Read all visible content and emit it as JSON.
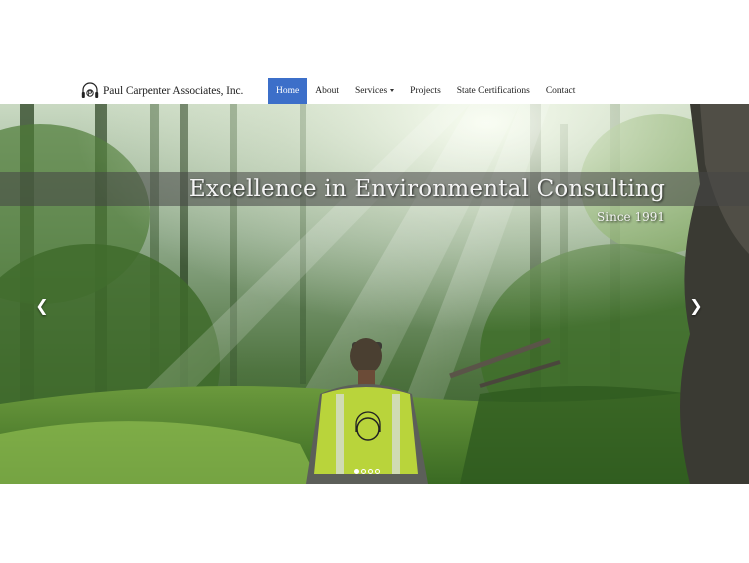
{
  "brand": {
    "name": "Paul Carpenter Associates, Inc.",
    "logo_icon": "pca-headphones-logo-icon"
  },
  "nav": {
    "items": [
      {
        "label": "Home",
        "active": true
      },
      {
        "label": "About",
        "active": false
      },
      {
        "label": "Services",
        "active": false,
        "dropdown": true
      },
      {
        "label": "Projects",
        "active": false
      },
      {
        "label": "State Certifications",
        "active": false
      },
      {
        "label": "Contact",
        "active": false
      }
    ],
    "active_color": "#3c6fc9"
  },
  "carousel": {
    "title": "Excellence in Environmental Consulting",
    "subtitle": "Since 1991",
    "prev_icon": "chevron-left-icon",
    "next_icon": "chevron-right-icon",
    "slide_count": 4,
    "active_slide": 1
  }
}
